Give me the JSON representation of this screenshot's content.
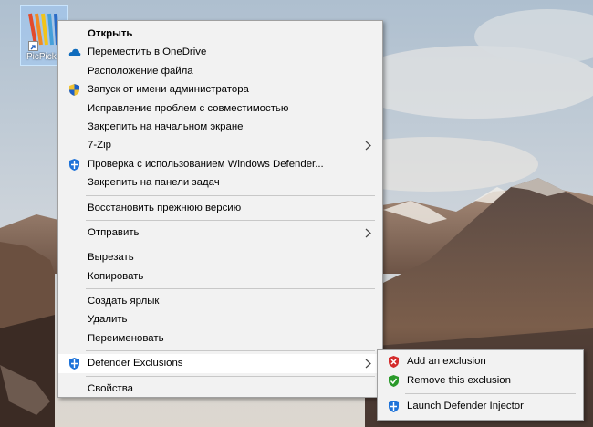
{
  "desktop": {
    "icon_label": "PicPick",
    "icon_name": "picpick-shortcut-icon"
  },
  "context_menu": {
    "items": [
      {
        "label": "Открыть",
        "bold": true
      },
      {
        "label": "Переместить в OneDrive",
        "icon": "onedrive-icon"
      },
      {
        "label": "Расположение файла"
      },
      {
        "label": "Запуск от имени администратора",
        "icon": "uac-shield-icon"
      },
      {
        "label": "Исправление проблем с совместимостью"
      },
      {
        "label": "Закрепить на начальном экране"
      },
      {
        "label": "7-Zip",
        "submenu": true
      },
      {
        "label": "Проверка с использованием Windows Defender...",
        "icon": "windows-defender-icon"
      },
      {
        "label": "Закрепить на панели задач"
      },
      {
        "label": "Восстановить прежнюю версию"
      },
      {
        "label": "Отправить",
        "submenu": true
      },
      {
        "label": "Вырезать"
      },
      {
        "label": "Копировать"
      },
      {
        "label": "Создать ярлык"
      },
      {
        "label": "Удалить"
      },
      {
        "label": "Переименовать"
      },
      {
        "label": "Defender Exclusions",
        "submenu": true,
        "highlighted": true,
        "icon": "defender-shield-icon"
      },
      {
        "label": "Свойства"
      }
    ]
  },
  "submenu": {
    "items": [
      {
        "label": "Add an exclusion",
        "icon": "red-shield-icon"
      },
      {
        "label": "Remove this exclusion",
        "icon": "green-shield-icon"
      },
      {
        "label": "Launch Defender Injector",
        "icon": "defender-shield-icon"
      }
    ]
  },
  "colors": {
    "menu_bg": "#f2f2f2",
    "highlight_bg": "#ffffff",
    "separator": "#c8c8c8",
    "onedrive_blue": "#0f6cbd",
    "defender_blue": "#1e73d9",
    "red_shield": "#d42b2b",
    "green_shield": "#2a9a2a"
  }
}
